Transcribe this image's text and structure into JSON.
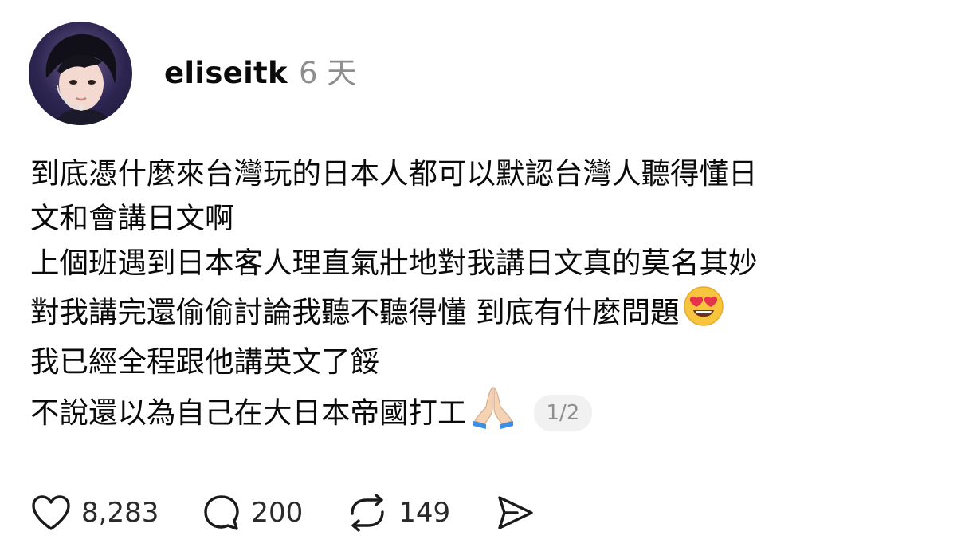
{
  "post": {
    "username": "eliseitk",
    "time": "6 天",
    "lines": [
      "到底憑什麼來台灣玩的日本人都可以默認台灣人聽得懂日",
      "文和會講日文啊",
      "上個班遇到日本客人理直氣壯地對我講日文真的莫名其妙",
      "對我講完還偷偷討論我聽不聽得懂 到底有什麼問題",
      "我已經全程跟他講英文了餒",
      "不說還以為自己在大日本帝國打工"
    ],
    "emojis": [
      "heart-eyes-emoji",
      "folded-hands-emoji"
    ],
    "page_indicator": "1/2"
  },
  "actions": {
    "likes": "8,283",
    "comments": "200",
    "reposts": "149"
  },
  "icons": [
    "heart-icon",
    "comment-icon",
    "repost-icon",
    "share-icon"
  ]
}
